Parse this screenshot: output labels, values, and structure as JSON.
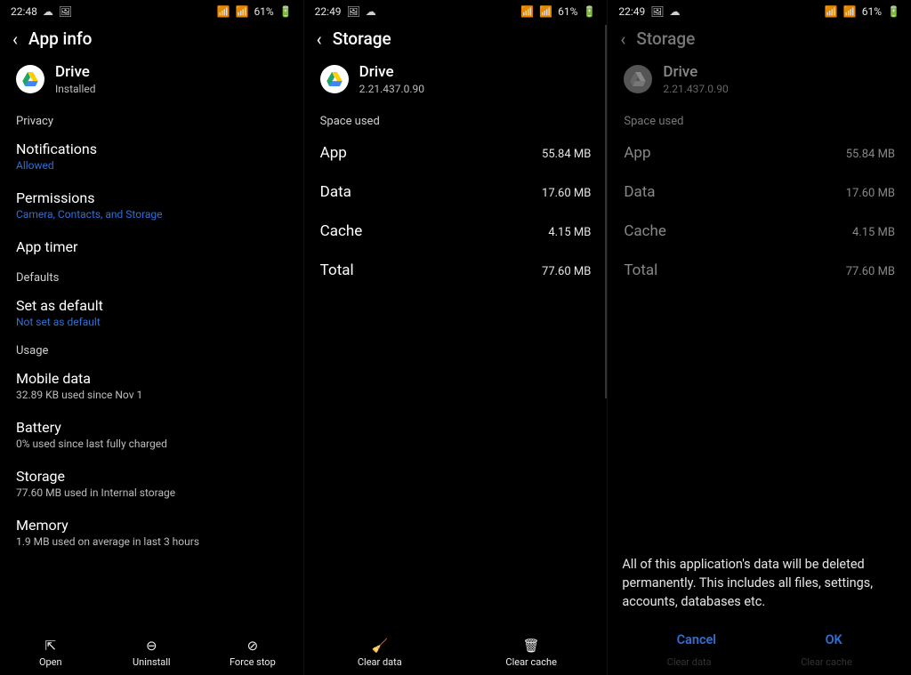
{
  "panes": [
    {
      "status": {
        "time": "22:48",
        "left_icons": [
          "☁",
          "🖼"
        ],
        "right_icons": [
          "📶",
          "📶",
          "61%",
          "🔋"
        ]
      },
      "title": "App info",
      "app": {
        "name": "Drive",
        "sub": "Installed"
      },
      "sections": [
        {
          "head": "Privacy",
          "items": [
            {
              "label": "Notifications",
              "sub": "Allowed",
              "sub_style": "link"
            },
            {
              "label": "Permissions",
              "sub": "Camera, Contacts, and Storage",
              "sub_style": "link"
            },
            {
              "label": "App timer"
            }
          ]
        },
        {
          "head": "Defaults",
          "items": [
            {
              "label": "Set as default",
              "sub": "Not set as default",
              "sub_style": "link"
            }
          ]
        },
        {
          "head": "Usage",
          "items": [
            {
              "label": "Mobile data",
              "sub": "32.89 KB used since Nov 1",
              "sub_style": "grey"
            },
            {
              "label": "Battery",
              "sub": "0% used since last fully charged",
              "sub_style": "grey"
            },
            {
              "label": "Storage",
              "sub": "77.60 MB used in Internal storage",
              "sub_style": "grey"
            },
            {
              "label": "Memory",
              "sub": "1.9 MB used on average in last 3 hours",
              "sub_style": "grey"
            }
          ]
        }
      ],
      "bottombar": [
        {
          "icon": "⇱",
          "label": "Open"
        },
        {
          "icon": "⊖",
          "label": "Uninstall"
        },
        {
          "icon": "⊘",
          "label": "Force stop"
        }
      ]
    },
    {
      "status": {
        "time": "22:49",
        "left_icons": [
          "🖼",
          "☁"
        ],
        "right_icons": [
          "📶",
          "📶",
          "61%",
          "🔋"
        ]
      },
      "title": "Storage",
      "app": {
        "name": "Drive",
        "sub": "2.21.437.0.90"
      },
      "space_head": "Space used",
      "rows": [
        {
          "k": "App",
          "v": "55.84 MB"
        },
        {
          "k": "Data",
          "v": "17.60 MB"
        },
        {
          "k": "Cache",
          "v": "4.15 MB"
        },
        {
          "k": "Total",
          "v": "77.60 MB"
        }
      ],
      "bottombar": [
        {
          "icon": "🧹",
          "label": "Clear data"
        },
        {
          "icon": "🗑",
          "label": "Clear cache"
        }
      ]
    },
    {
      "status": {
        "time": "22:49",
        "left_icons": [
          "🖼",
          "☁"
        ],
        "right_icons": [
          "📶",
          "📶",
          "61%",
          "🔋"
        ]
      },
      "title": "Storage",
      "app": {
        "name": "Drive",
        "sub": "2.21.437.0.90"
      },
      "space_head": "Space used",
      "rows": [
        {
          "k": "App",
          "v": "55.84 MB"
        },
        {
          "k": "Data",
          "v": "17.60 MB"
        },
        {
          "k": "Cache",
          "v": "4.15 MB"
        },
        {
          "k": "Total",
          "v": "77.60 MB"
        }
      ],
      "dialog": {
        "msg": "All of this application's data will be deleted permanently. This includes all files, settings, accounts, databases etc.",
        "cancel": "Cancel",
        "ok": "OK"
      },
      "ghostbar": [
        "Clear data",
        "Clear cache"
      ]
    }
  ]
}
